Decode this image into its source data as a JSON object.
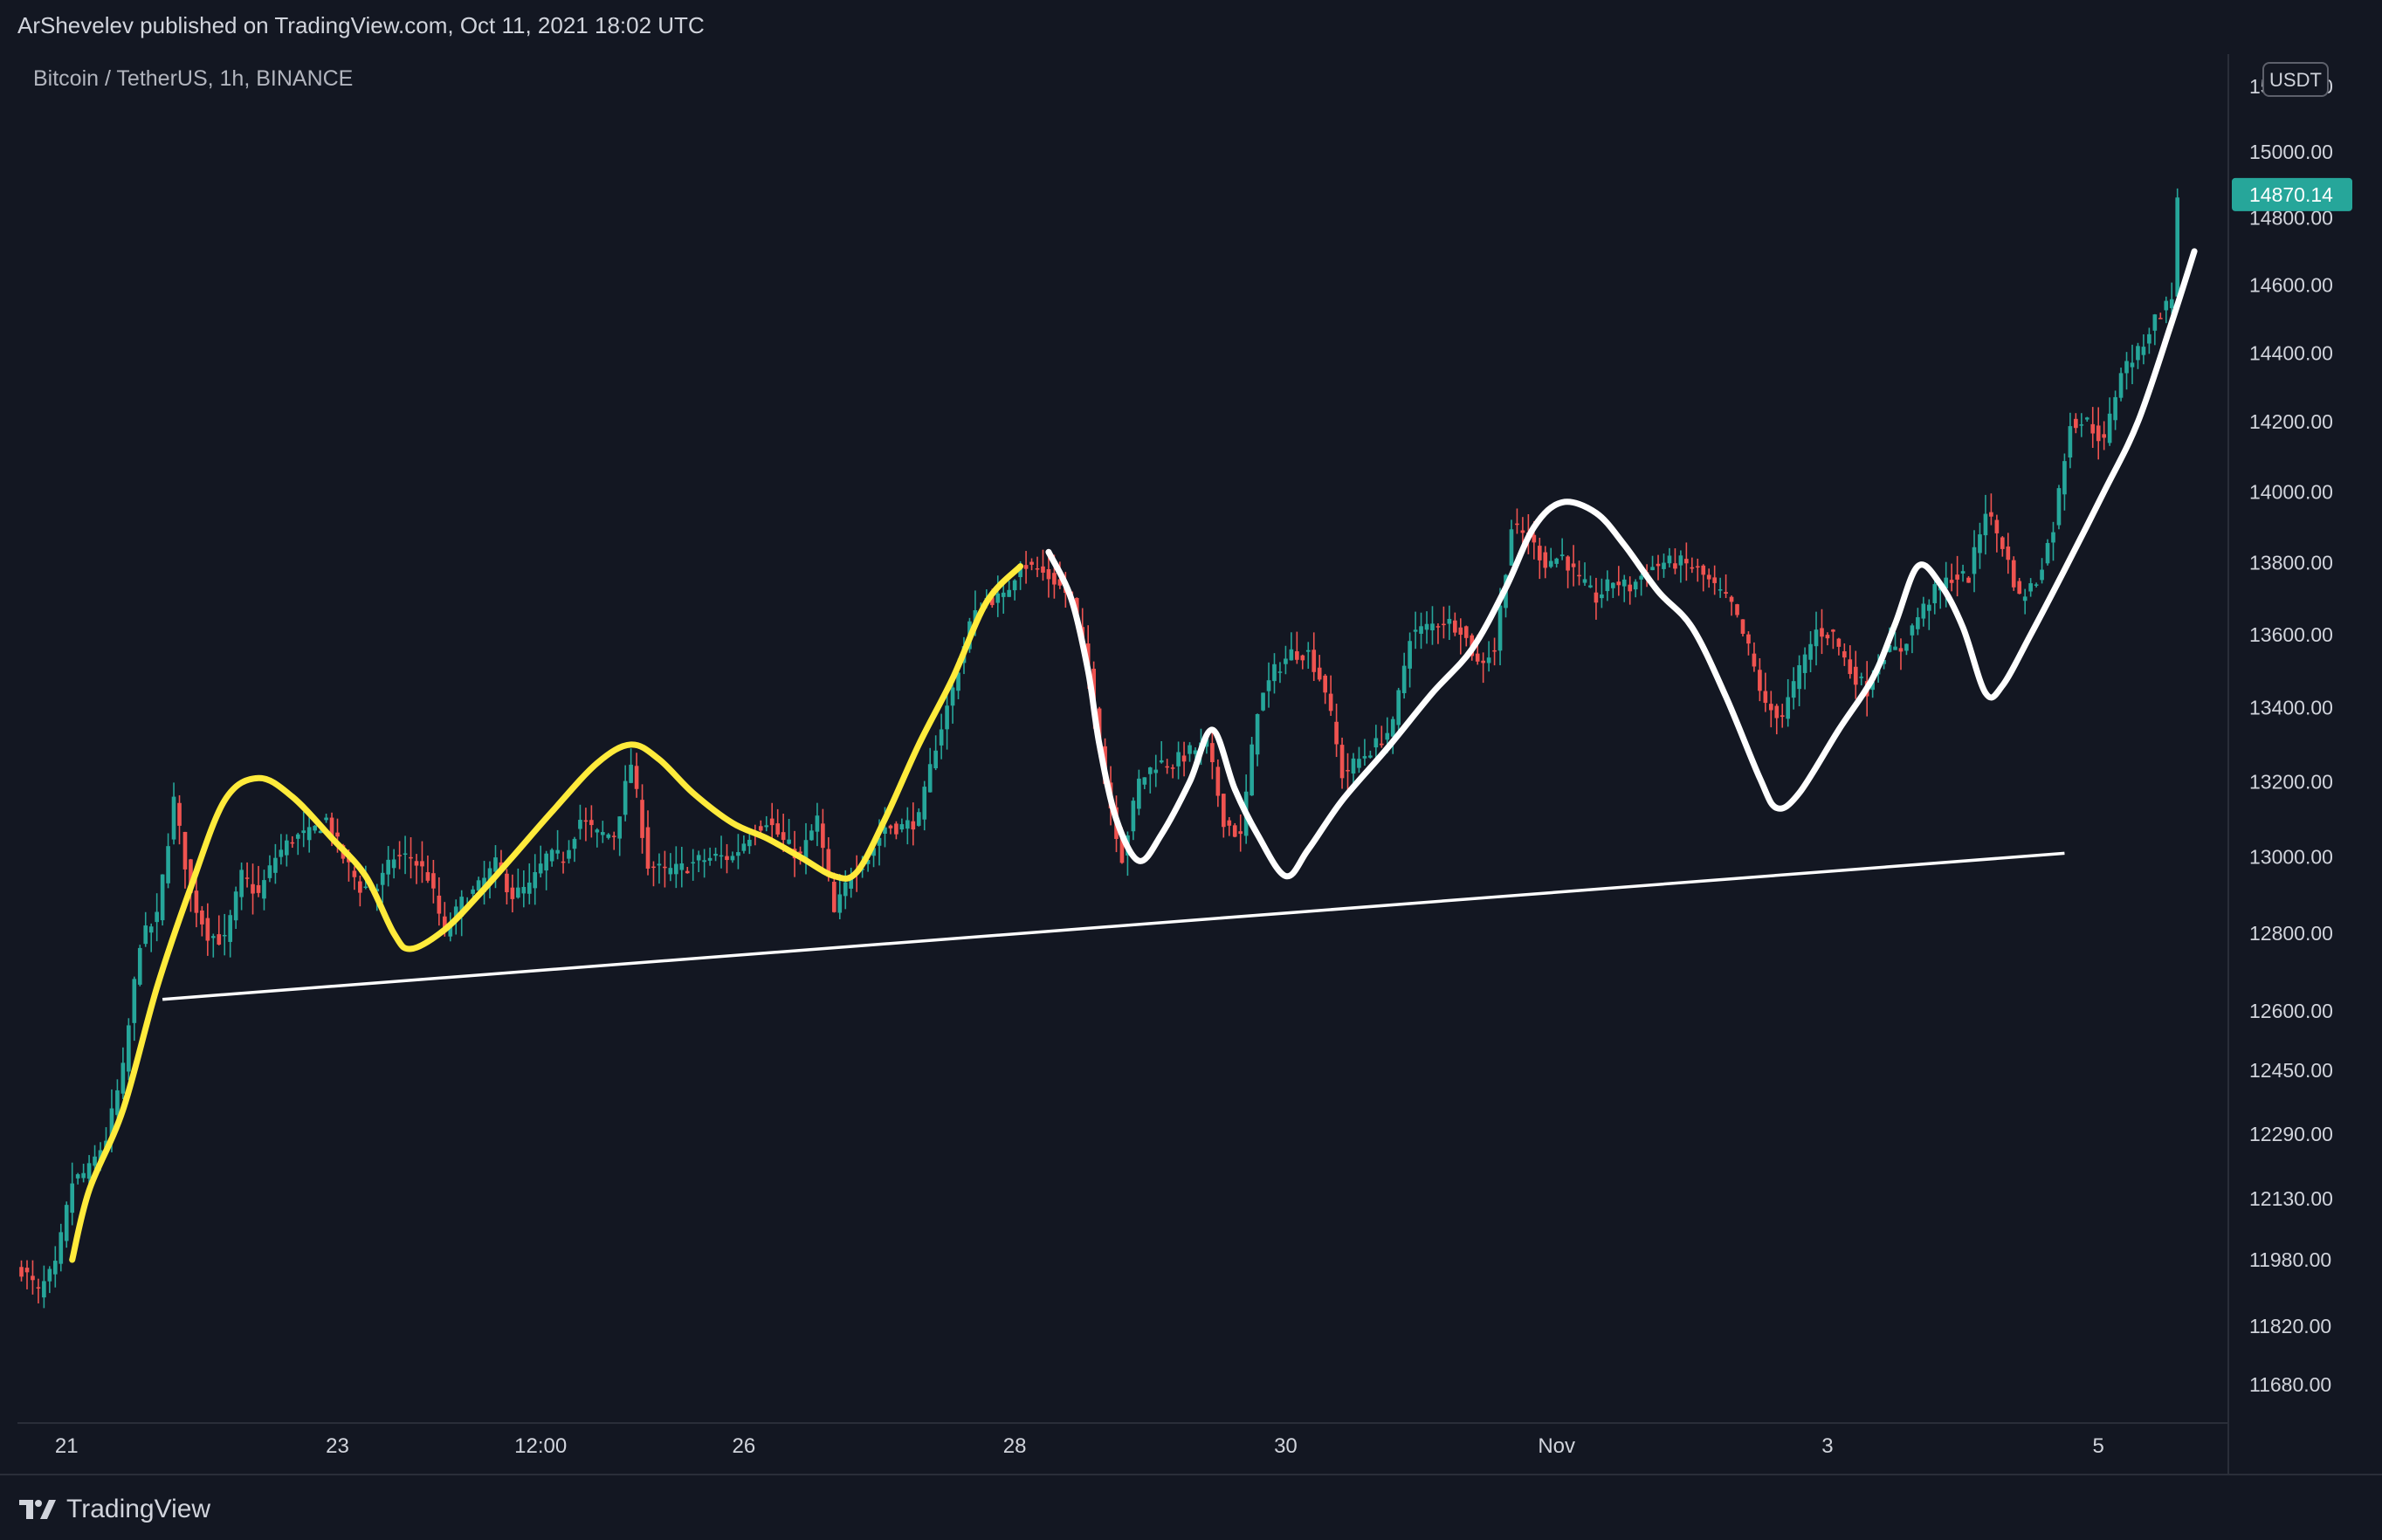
{
  "header": {
    "published_by": "ArShevelev published on TradingView.com, Oct 11, 2021 18:02 UTC"
  },
  "symbol": {
    "title": "Bitcoin / TetherUS, 1h, BINANCE"
  },
  "price_axis": {
    "currency": "USDT",
    "last_price": "14870.14",
    "colors": {
      "up": "#26a69a",
      "down": "#ef5350",
      "last_badge": "#26a69a"
    }
  },
  "footer": {
    "brand": "TradingView"
  },
  "chart_data": {
    "type": "candlestick",
    "title": "Bitcoin / TetherUS, 1h, BINANCE",
    "y_scale": "log",
    "ylim": [
      11600,
      15300
    ],
    "yticks": [
      11680,
      11820,
      11980,
      12130,
      12290,
      12450,
      12600,
      12800,
      13000,
      13200,
      13400,
      13600,
      13800,
      14000,
      14200,
      14400,
      14600,
      14800,
      15000,
      15200
    ],
    "ytick_labels": [
      "11680.00",
      "11820.00",
      "11980.00",
      "12130.00",
      "12290.00",
      "12450.00",
      "12600.00",
      "12800.00",
      "13000.00",
      "13200.00",
      "13400.00",
      "13600.00",
      "13800.00",
      "14000.00",
      "14200.00",
      "14400.00",
      "14600.00",
      "14800.00",
      "15000.00",
      "15200.00"
    ],
    "xlim": [
      -0.7,
      390.4
    ],
    "xticks": [
      {
        "label": "21",
        "pos": 8
      },
      {
        "label": "23",
        "pos": 56
      },
      {
        "label": "12:00",
        "pos": 92
      },
      {
        "label": "26",
        "pos": 128
      },
      {
        "label": "28",
        "pos": 176
      },
      {
        "label": "30",
        "pos": 224
      },
      {
        "label": "Nov",
        "pos": 272
      },
      {
        "label": "3",
        "pos": 320
      },
      {
        "label": "5",
        "pos": 368
      }
    ],
    "grid": false,
    "anchors": [
      [
        0,
        11960
      ],
      [
        3,
        11900
      ],
      [
        6,
        11960
      ],
      [
        9,
        12170
      ],
      [
        12,
        12200
      ],
      [
        15,
        12280
      ],
      [
        18,
        12450
      ],
      [
        21,
        12780
      ],
      [
        24,
        12840
      ],
      [
        27,
        13150
      ],
      [
        30,
        12900
      ],
      [
        33,
        12800
      ],
      [
        36,
        12780
      ],
      [
        39,
        12950
      ],
      [
        42,
        12900
      ],
      [
        45,
        13000
      ],
      [
        48,
        13050
      ],
      [
        51,
        13060
      ],
      [
        54,
        13100
      ],
      [
        57,
        13000
      ],
      [
        60,
        12920
      ],
      [
        63,
        12920
      ],
      [
        66,
        13000
      ],
      [
        69,
        13000
      ],
      [
        72,
        12950
      ],
      [
        75,
        12800
      ],
      [
        78,
        12880
      ],
      [
        81,
        12920
      ],
      [
        84,
        12980
      ],
      [
        87,
        12900
      ],
      [
        90,
        12920
      ],
      [
        93,
        13000
      ],
      [
        96,
        13000
      ],
      [
        99,
        13100
      ],
      [
        102,
        13060
      ],
      [
        105,
        13060
      ],
      [
        108,
        13250
      ],
      [
        111,
        12980
      ],
      [
        114,
        12960
      ],
      [
        117,
        12970
      ],
      [
        120,
        12990
      ],
      [
        123,
        13000
      ],
      [
        126,
        13000
      ],
      [
        129,
        13060
      ],
      [
        132,
        13100
      ],
      [
        135,
        13040
      ],
      [
        138,
        13000
      ],
      [
        141,
        13100
      ],
      [
        144,
        12850
      ],
      [
        147,
        12960
      ],
      [
        150,
        13000
      ],
      [
        153,
        13080
      ],
      [
        156,
        13080
      ],
      [
        159,
        13100
      ],
      [
        162,
        13300
      ],
      [
        165,
        13450
      ],
      [
        168,
        13630
      ],
      [
        171,
        13700
      ],
      [
        174,
        13700
      ],
      [
        177,
        13800
      ],
      [
        180,
        13780
      ],
      [
        183,
        13750
      ],
      [
        186,
        13700
      ],
      [
        189,
        13500
      ],
      [
        192,
        13200
      ],
      [
        195,
        13000
      ],
      [
        198,
        13200
      ],
      [
        201,
        13250
      ],
      [
        204,
        13250
      ],
      [
        207,
        13280
      ],
      [
        210,
        13300
      ],
      [
        213,
        13100
      ],
      [
        216,
        13050
      ],
      [
        219,
        13400
      ],
      [
        222,
        13500
      ],
      [
        225,
        13550
      ],
      [
        228,
        13550
      ],
      [
        231,
        13450
      ],
      [
        234,
        13220
      ],
      [
        237,
        13260
      ],
      [
        240,
        13300
      ],
      [
        243,
        13350
      ],
      [
        246,
        13600
      ],
      [
        249,
        13620
      ],
      [
        252,
        13640
      ],
      [
        255,
        13620
      ],
      [
        258,
        13520
      ],
      [
        261,
        13560
      ],
      [
        264,
        13900
      ],
      [
        267,
        13870
      ],
      [
        270,
        13800
      ],
      [
        273,
        13820
      ],
      [
        276,
        13750
      ],
      [
        279,
        13700
      ],
      [
        282,
        13750
      ],
      [
        285,
        13730
      ],
      [
        288,
        13780
      ],
      [
        291,
        13800
      ],
      [
        294,
        13800
      ],
      [
        297,
        13780
      ],
      [
        300,
        13730
      ],
      [
        303,
        13680
      ],
      [
        306,
        13560
      ],
      [
        309,
        13400
      ],
      [
        312,
        13380
      ],
      [
        315,
        13500
      ],
      [
        318,
        13610
      ],
      [
        321,
        13600
      ],
      [
        324,
        13500
      ],
      [
        327,
        13450
      ],
      [
        330,
        13550
      ],
      [
        333,
        13560
      ],
      [
        336,
        13650
      ],
      [
        339,
        13720
      ],
      [
        342,
        13760
      ],
      [
        345,
        13760
      ],
      [
        348,
        13950
      ],
      [
        351,
        13850
      ],
      [
        354,
        13700
      ],
      [
        357,
        13750
      ],
      [
        360,
        13900
      ],
      [
        363,
        14200
      ],
      [
        366,
        14200
      ],
      [
        369,
        14140
      ],
      [
        372,
        14350
      ],
      [
        375,
        14400
      ],
      [
        378,
        14500
      ],
      [
        381,
        14560
      ],
      [
        382,
        14870
      ]
    ],
    "overlays": [
      {
        "name": "trendline",
        "color": "#ffffff",
        "points": [
          [
            25,
            12630
          ],
          [
            362,
            13010
          ]
        ]
      },
      {
        "name": "yellow-wave",
        "color": "#ffeb3b",
        "points": [
          [
            9,
            11980
          ],
          [
            12,
            12150
          ],
          [
            18,
            12350
          ],
          [
            24,
            12660
          ],
          [
            30,
            12920
          ],
          [
            36,
            13150
          ],
          [
            42,
            13210
          ],
          [
            48,
            13160
          ],
          [
            55,
            13050
          ],
          [
            61,
            12950
          ],
          [
            66,
            12800
          ],
          [
            69,
            12760
          ],
          [
            75,
            12810
          ],
          [
            81,
            12900
          ],
          [
            87,
            13000
          ],
          [
            94,
            13120
          ],
          [
            102,
            13250
          ],
          [
            108,
            13300
          ],
          [
            113,
            13260
          ],
          [
            119,
            13170
          ],
          [
            126,
            13090
          ],
          [
            132,
            13050
          ],
          [
            138,
            13000
          ],
          [
            144,
            12950
          ],
          [
            148,
            12960
          ],
          [
            153,
            13100
          ],
          [
            159,
            13300
          ],
          [
            165,
            13480
          ],
          [
            171,
            13690
          ],
          [
            177,
            13790
          ]
        ]
      },
      {
        "name": "white-wave",
        "color": "#ffffff",
        "points": [
          [
            182,
            13830
          ],
          [
            186,
            13700
          ],
          [
            189,
            13500
          ],
          [
            191,
            13300
          ],
          [
            194,
            13100
          ],
          [
            198,
            12990
          ],
          [
            202,
            13060
          ],
          [
            207,
            13200
          ],
          [
            211,
            13340
          ],
          [
            215,
            13180
          ],
          [
            219,
            13060
          ],
          [
            224,
            12950
          ],
          [
            228,
            13020
          ],
          [
            234,
            13150
          ],
          [
            242,
            13290
          ],
          [
            250,
            13440
          ],
          [
            257,
            13560
          ],
          [
            263,
            13730
          ],
          [
            268,
            13900
          ],
          [
            273,
            13970
          ],
          [
            279,
            13940
          ],
          [
            284,
            13850
          ],
          [
            290,
            13720
          ],
          [
            296,
            13620
          ],
          [
            302,
            13430
          ],
          [
            308,
            13210
          ],
          [
            311,
            13130
          ],
          [
            315,
            13170
          ],
          [
            322,
            13340
          ],
          [
            328,
            13480
          ],
          [
            332,
            13630
          ],
          [
            336,
            13790
          ],
          [
            340,
            13740
          ],
          [
            344,
            13620
          ],
          [
            348,
            13440
          ],
          [
            351,
            13460
          ],
          [
            356,
            13600
          ],
          [
            362,
            13780
          ],
          [
            369,
            14000
          ],
          [
            375,
            14200
          ],
          [
            381,
            14490
          ],
          [
            385,
            14700
          ]
        ]
      }
    ]
  }
}
